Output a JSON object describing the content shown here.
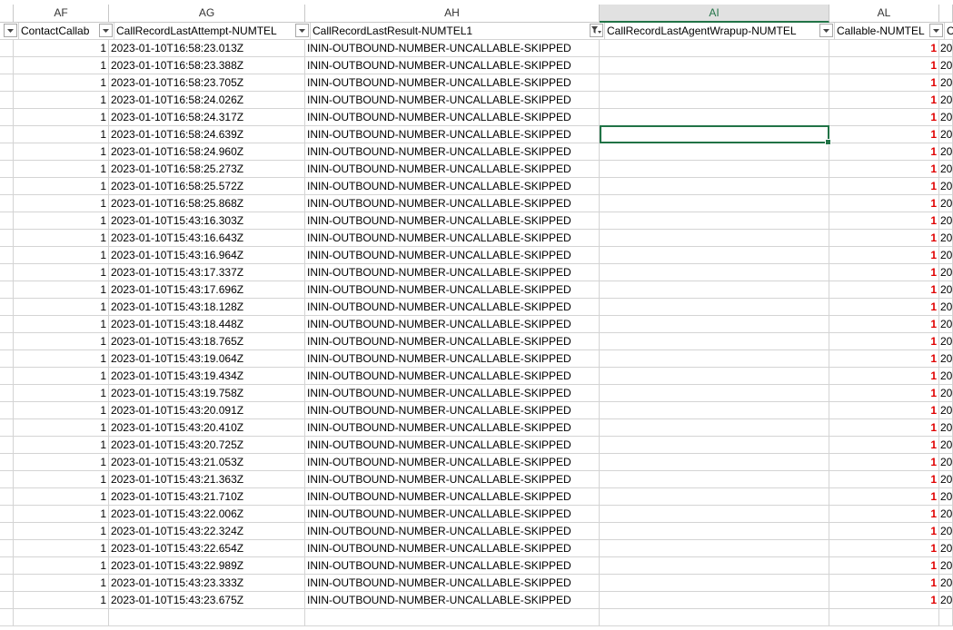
{
  "columns": [
    "",
    "AF",
    "AG",
    "AH",
    "AI",
    "AL",
    ""
  ],
  "selected_column": "AI",
  "headers": [
    "",
    "ContactCallab",
    "CallRecordLastAttempt-NUMTEL",
    "CallRecordLastResult-NUMTEL1",
    "CallRecordLastAgentWrapup-NUMTEL",
    "Callable-NUMTEL",
    "Ca"
  ],
  "rows": [
    {
      "af": "1",
      "ag": "2023-01-10T16:58:23.013Z",
      "ah": "ININ-OUTBOUND-NUMBER-UNCALLABLE-SKIPPED",
      "ai": "",
      "al": "1",
      "am": "20"
    },
    {
      "af": "1",
      "ag": "2023-01-10T16:58:23.388Z",
      "ah": "ININ-OUTBOUND-NUMBER-UNCALLABLE-SKIPPED",
      "ai": "",
      "al": "1",
      "am": "20"
    },
    {
      "af": "1",
      "ag": "2023-01-10T16:58:23.705Z",
      "ah": "ININ-OUTBOUND-NUMBER-UNCALLABLE-SKIPPED",
      "ai": "",
      "al": "1",
      "am": "20"
    },
    {
      "af": "1",
      "ag": "2023-01-10T16:58:24.026Z",
      "ah": "ININ-OUTBOUND-NUMBER-UNCALLABLE-SKIPPED",
      "ai": "",
      "al": "1",
      "am": "20"
    },
    {
      "af": "1",
      "ag": "2023-01-10T16:58:24.317Z",
      "ah": "ININ-OUTBOUND-NUMBER-UNCALLABLE-SKIPPED",
      "ai": "",
      "al": "1",
      "am": "20"
    },
    {
      "af": "1",
      "ag": "2023-01-10T16:58:24.639Z",
      "ah": "ININ-OUTBOUND-NUMBER-UNCALLABLE-SKIPPED",
      "ai": "",
      "al": "1",
      "am": "20"
    },
    {
      "af": "1",
      "ag": "2023-01-10T16:58:24.960Z",
      "ah": "ININ-OUTBOUND-NUMBER-UNCALLABLE-SKIPPED",
      "ai": "",
      "al": "1",
      "am": "20"
    },
    {
      "af": "1",
      "ag": "2023-01-10T16:58:25.273Z",
      "ah": "ININ-OUTBOUND-NUMBER-UNCALLABLE-SKIPPED",
      "ai": "",
      "al": "1",
      "am": "20"
    },
    {
      "af": "1",
      "ag": "2023-01-10T16:58:25.572Z",
      "ah": "ININ-OUTBOUND-NUMBER-UNCALLABLE-SKIPPED",
      "ai": "",
      "al": "1",
      "am": "20"
    },
    {
      "af": "1",
      "ag": "2023-01-10T16:58:25.868Z",
      "ah": "ININ-OUTBOUND-NUMBER-UNCALLABLE-SKIPPED",
      "ai": "",
      "al": "1",
      "am": "20"
    },
    {
      "af": "1",
      "ag": "2023-01-10T15:43:16.303Z",
      "ah": "ININ-OUTBOUND-NUMBER-UNCALLABLE-SKIPPED",
      "ai": "",
      "al": "1",
      "am": "20"
    },
    {
      "af": "1",
      "ag": "2023-01-10T15:43:16.643Z",
      "ah": "ININ-OUTBOUND-NUMBER-UNCALLABLE-SKIPPED",
      "ai": "",
      "al": "1",
      "am": "20"
    },
    {
      "af": "1",
      "ag": "2023-01-10T15:43:16.964Z",
      "ah": "ININ-OUTBOUND-NUMBER-UNCALLABLE-SKIPPED",
      "ai": "",
      "al": "1",
      "am": "20"
    },
    {
      "af": "1",
      "ag": "2023-01-10T15:43:17.337Z",
      "ah": "ININ-OUTBOUND-NUMBER-UNCALLABLE-SKIPPED",
      "ai": "",
      "al": "1",
      "am": "20"
    },
    {
      "af": "1",
      "ag": "2023-01-10T15:43:17.696Z",
      "ah": "ININ-OUTBOUND-NUMBER-UNCALLABLE-SKIPPED",
      "ai": "",
      "al": "1",
      "am": "20"
    },
    {
      "af": "1",
      "ag": "2023-01-10T15:43:18.128Z",
      "ah": "ININ-OUTBOUND-NUMBER-UNCALLABLE-SKIPPED",
      "ai": "",
      "al": "1",
      "am": "20"
    },
    {
      "af": "1",
      "ag": "2023-01-10T15:43:18.448Z",
      "ah": "ININ-OUTBOUND-NUMBER-UNCALLABLE-SKIPPED",
      "ai": "",
      "al": "1",
      "am": "20"
    },
    {
      "af": "1",
      "ag": "2023-01-10T15:43:18.765Z",
      "ah": "ININ-OUTBOUND-NUMBER-UNCALLABLE-SKIPPED",
      "ai": "",
      "al": "1",
      "am": "20"
    },
    {
      "af": "1",
      "ag": "2023-01-10T15:43:19.064Z",
      "ah": "ININ-OUTBOUND-NUMBER-UNCALLABLE-SKIPPED",
      "ai": "",
      "al": "1",
      "am": "20"
    },
    {
      "af": "1",
      "ag": "2023-01-10T15:43:19.434Z",
      "ah": "ININ-OUTBOUND-NUMBER-UNCALLABLE-SKIPPED",
      "ai": "",
      "al": "1",
      "am": "20"
    },
    {
      "af": "1",
      "ag": "2023-01-10T15:43:19.758Z",
      "ah": "ININ-OUTBOUND-NUMBER-UNCALLABLE-SKIPPED",
      "ai": "",
      "al": "1",
      "am": "20"
    },
    {
      "af": "1",
      "ag": "2023-01-10T15:43:20.091Z",
      "ah": "ININ-OUTBOUND-NUMBER-UNCALLABLE-SKIPPED",
      "ai": "",
      "al": "1",
      "am": "20"
    },
    {
      "af": "1",
      "ag": "2023-01-10T15:43:20.410Z",
      "ah": "ININ-OUTBOUND-NUMBER-UNCALLABLE-SKIPPED",
      "ai": "",
      "al": "1",
      "am": "20"
    },
    {
      "af": "1",
      "ag": "2023-01-10T15:43:20.725Z",
      "ah": "ININ-OUTBOUND-NUMBER-UNCALLABLE-SKIPPED",
      "ai": "",
      "al": "1",
      "am": "20"
    },
    {
      "af": "1",
      "ag": "2023-01-10T15:43:21.053Z",
      "ah": "ININ-OUTBOUND-NUMBER-UNCALLABLE-SKIPPED",
      "ai": "",
      "al": "1",
      "am": "20"
    },
    {
      "af": "1",
      "ag": "2023-01-10T15:43:21.363Z",
      "ah": "ININ-OUTBOUND-NUMBER-UNCALLABLE-SKIPPED",
      "ai": "",
      "al": "1",
      "am": "20"
    },
    {
      "af": "1",
      "ag": "2023-01-10T15:43:21.710Z",
      "ah": "ININ-OUTBOUND-NUMBER-UNCALLABLE-SKIPPED",
      "ai": "",
      "al": "1",
      "am": "20"
    },
    {
      "af": "1",
      "ag": "2023-01-10T15:43:22.006Z",
      "ah": "ININ-OUTBOUND-NUMBER-UNCALLABLE-SKIPPED",
      "ai": "",
      "al": "1",
      "am": "20"
    },
    {
      "af": "1",
      "ag": "2023-01-10T15:43:22.324Z",
      "ah": "ININ-OUTBOUND-NUMBER-UNCALLABLE-SKIPPED",
      "ai": "",
      "al": "1",
      "am": "20"
    },
    {
      "af": "1",
      "ag": "2023-01-10T15:43:22.654Z",
      "ah": "ININ-OUTBOUND-NUMBER-UNCALLABLE-SKIPPED",
      "ai": "",
      "al": "1",
      "am": "20"
    },
    {
      "af": "1",
      "ag": "2023-01-10T15:43:22.989Z",
      "ah": "ININ-OUTBOUND-NUMBER-UNCALLABLE-SKIPPED",
      "ai": "",
      "al": "1",
      "am": "20"
    },
    {
      "af": "1",
      "ag": "2023-01-10T15:43:23.333Z",
      "ah": "ININ-OUTBOUND-NUMBER-UNCALLABLE-SKIPPED",
      "ai": "",
      "al": "1",
      "am": "20"
    },
    {
      "af": "1",
      "ag": "2023-01-10T15:43:23.675Z",
      "ah": "ININ-OUTBOUND-NUMBER-UNCALLABLE-SKIPPED",
      "ai": "",
      "al": "1",
      "am": "20"
    }
  ],
  "colors": {
    "accent": "#217346",
    "red_value": "#e00000",
    "gridline": "#d4d4d4"
  },
  "icons": {
    "filter": "dropdown-arrow-icon",
    "active_filter": "funnel-filter-icon"
  }
}
